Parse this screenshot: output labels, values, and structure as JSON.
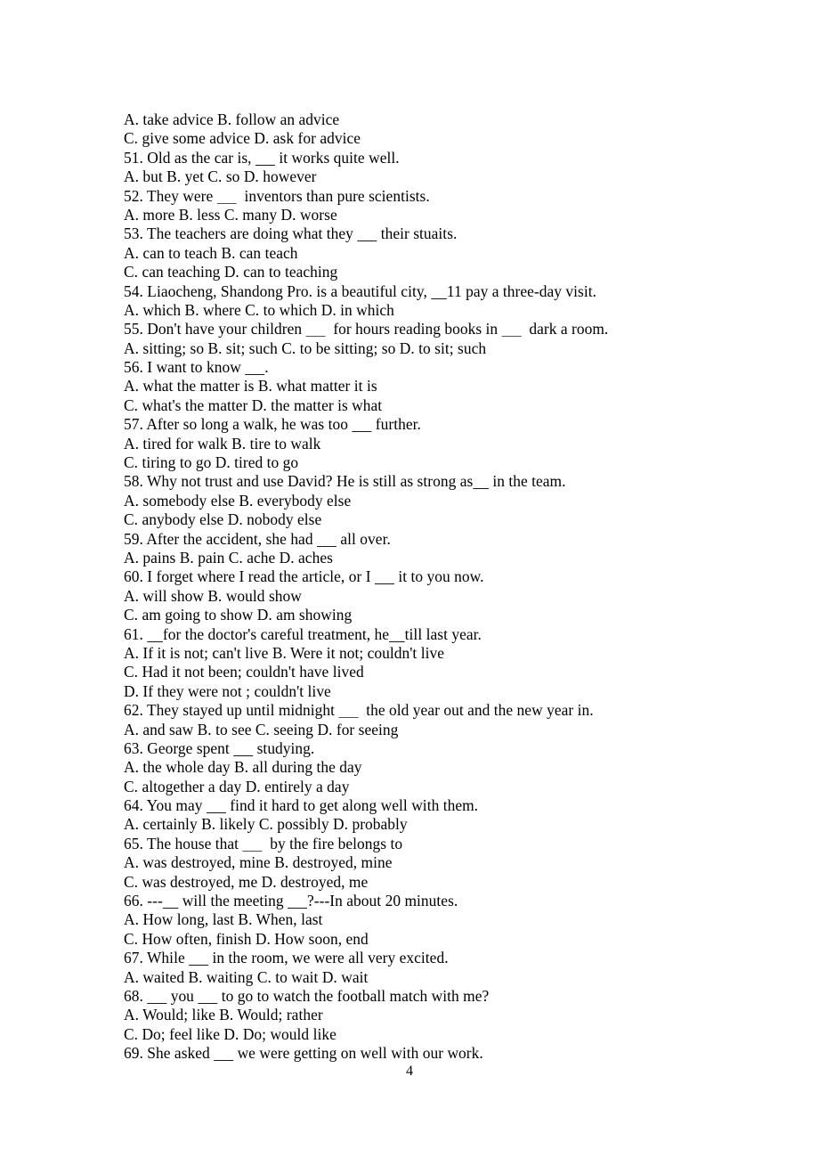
{
  "document": {
    "page_number": "4",
    "lines": [
      {
        "id": "line-opt-50-ab",
        "segments": [
          {
            "t": "A. take advice B. follow an advice"
          }
        ]
      },
      {
        "id": "line-opt-50-cd",
        "segments": [
          {
            "t": "C. give some advice D. ask for advice"
          }
        ]
      },
      {
        "id": "line-q51",
        "segments": [
          {
            "t": "51. Old as the car is, "
          },
          {
            "blank": "_____"
          },
          {
            "t": " it works quite well."
          }
        ]
      },
      {
        "id": "line-opt-51-ab",
        "segments": [
          {
            "t": "A. but B. yet C. so D. however"
          }
        ]
      },
      {
        "id": "line-q52",
        "segments": [
          {
            "t": "52. They were "
          },
          {
            "blank": "_____",
            "faint": true
          },
          {
            "t": "  inventors than pure scientists."
          }
        ]
      },
      {
        "id": "line-opt-52",
        "segments": [
          {
            "t": "A. more B. less C. many D. worse"
          }
        ]
      },
      {
        "id": "line-q53",
        "segments": [
          {
            "t": "53. The teachers are doing what they "
          },
          {
            "blank": "_____"
          },
          {
            "t": " their stuaits."
          }
        ]
      },
      {
        "id": "line-opt-53-ab",
        "segments": [
          {
            "t": "A. can to teach B. can teach"
          }
        ]
      },
      {
        "id": "line-opt-53-cd",
        "segments": [
          {
            "t": "C. can teaching D. can to teaching"
          }
        ]
      },
      {
        "id": "line-q54",
        "segments": [
          {
            "t": "54. Liaocheng, Shandong Pro. is a beautiful city, "
          },
          {
            "blank": "____"
          },
          {
            "t": "11 pay a three-day visit."
          }
        ]
      },
      {
        "id": "line-opt-54",
        "segments": [
          {
            "t": "A. which B. where C. to which D. in which"
          }
        ]
      },
      {
        "id": "line-q55",
        "segments": [
          {
            "t": "55. Don't have your children "
          },
          {
            "blank": "_____",
            "faint": true
          },
          {
            "t": "  for hours reading books in "
          },
          {
            "blank": "_____",
            "faint": true
          },
          {
            "t": "  dark a room."
          }
        ]
      },
      {
        "id": "line-opt-55",
        "segments": [
          {
            "t": "A. sitting; so B. sit; such C. to be sitting; so D. to sit; such"
          }
        ]
      },
      {
        "id": "line-q56",
        "segments": [
          {
            "t": "56. I want to know "
          },
          {
            "blank": "_____"
          },
          {
            "t": "."
          }
        ]
      },
      {
        "id": "line-opt-56-ab",
        "segments": [
          {
            "t": "A. what the matter is B. what matter it is"
          }
        ]
      },
      {
        "id": "line-opt-56-cd",
        "segments": [
          {
            "t": "C. what's the matter D. the matter is what"
          }
        ]
      },
      {
        "id": "line-q57",
        "segments": [
          {
            "t": "57. After so long a walk, he was too "
          },
          {
            "blank": "_____"
          },
          {
            "t": " further."
          }
        ]
      },
      {
        "id": "line-opt-57-ab",
        "segments": [
          {
            "t": "A. tired for walk B. tire to walk"
          }
        ]
      },
      {
        "id": "line-opt-57-cd",
        "segments": [
          {
            "t": "C. tiring to go D. tired to go"
          }
        ]
      },
      {
        "id": "line-q58",
        "segments": [
          {
            "t": "58. Why not trust and use David? He is still as strong as"
          },
          {
            "blank": "____"
          },
          {
            "t": " in the team."
          }
        ]
      },
      {
        "id": "line-opt-58-ab",
        "segments": [
          {
            "t": "A. somebody else B. everybody else"
          }
        ]
      },
      {
        "id": "line-opt-58-cd",
        "segments": [
          {
            "t": "C. anybody else D. nobody else"
          }
        ]
      },
      {
        "id": "line-q59",
        "segments": [
          {
            "t": "59. After the accident, she had "
          },
          {
            "blank": "_____"
          },
          {
            "t": " all over."
          }
        ]
      },
      {
        "id": "line-opt-59",
        "segments": [
          {
            "t": "A. pains B. pain C. ache D. aches"
          }
        ]
      },
      {
        "id": "line-q60",
        "segments": [
          {
            "t": "60. I forget where I read the article, or I "
          },
          {
            "blank": "_____"
          },
          {
            "t": " it to you now."
          }
        ]
      },
      {
        "id": "line-opt-60-ab",
        "segments": [
          {
            "t": "A. will show B. would show"
          }
        ]
      },
      {
        "id": "line-opt-60-cd",
        "segments": [
          {
            "t": "C. am going to show D. am showing"
          }
        ]
      },
      {
        "id": "line-q61",
        "segments": [
          {
            "t": "61. "
          },
          {
            "blank": "____"
          },
          {
            "t": "for the doctor's careful treatment, he"
          },
          {
            "blank": "____"
          },
          {
            "t": "till last year."
          }
        ]
      },
      {
        "id": "line-opt-61-ab",
        "segments": [
          {
            "t": "A. If it is not; can't live B. Were it not; couldn't live"
          }
        ]
      },
      {
        "id": "line-opt-61-c",
        "segments": [
          {
            "t": "C. Had it not been; couldn't have lived"
          }
        ]
      },
      {
        "id": "line-opt-61-d",
        "segments": [
          {
            "t": "D. If they were not ; couldn't live"
          }
        ]
      },
      {
        "id": "line-q62",
        "segments": [
          {
            "t": "62. They stayed up until midnight "
          },
          {
            "blank": "_____",
            "faint": true
          },
          {
            "t": "  the old year out and the new year in."
          }
        ]
      },
      {
        "id": "line-opt-62",
        "segments": [
          {
            "t": "A. and saw B. to see C. seeing D. for seeing"
          }
        ]
      },
      {
        "id": "line-q63",
        "segments": [
          {
            "t": "63. George spent "
          },
          {
            "blank": "_____"
          },
          {
            "t": " studying."
          }
        ]
      },
      {
        "id": "line-opt-63-ab",
        "segments": [
          {
            "t": "A. the whole day B. all during the day"
          }
        ]
      },
      {
        "id": "line-opt-63-cd",
        "segments": [
          {
            "t": "C. altogether a day D. entirely a day"
          }
        ]
      },
      {
        "id": "line-q64",
        "segments": [
          {
            "t": "64. You may "
          },
          {
            "blank": "_____"
          },
          {
            "t": " find it hard to get along well with them."
          }
        ]
      },
      {
        "id": "line-opt-64",
        "segments": [
          {
            "t": "A. certainly B. likely C. possibly D. probably"
          }
        ]
      },
      {
        "id": "line-q65",
        "segments": [
          {
            "t": "65. The house that "
          },
          {
            "blank": "_____",
            "faint": true
          },
          {
            "t": "  by the fire belongs to"
          }
        ]
      },
      {
        "id": "line-opt-65-ab",
        "segments": [
          {
            "t": "A. was destroyed, mine B. destroyed, mine"
          }
        ]
      },
      {
        "id": "line-opt-65-cd",
        "segments": [
          {
            "t": "C. was destroyed, me D. destroyed, me"
          }
        ]
      },
      {
        "id": "line-q66",
        "segments": [
          {
            "t": "66. ---"
          },
          {
            "blank": "____"
          },
          {
            "t": " will the meeting "
          },
          {
            "blank": "_____"
          },
          {
            "t": "?---In about 20 minutes."
          }
        ]
      },
      {
        "id": "line-opt-66-ab",
        "segments": [
          {
            "t": "A. How long, last B. When, last"
          }
        ]
      },
      {
        "id": "line-opt-66-cd",
        "segments": [
          {
            "t": "C. How often, finish D. How soon, end"
          }
        ]
      },
      {
        "id": "line-q67",
        "segments": [
          {
            "t": "67. While "
          },
          {
            "blank": "_____"
          },
          {
            "t": " in the room, we were all very excited."
          }
        ]
      },
      {
        "id": "line-opt-67",
        "segments": [
          {
            "t": "A. waited B. waiting C. to wait D. wait"
          }
        ]
      },
      {
        "id": "line-q68",
        "segments": [
          {
            "t": "68. "
          },
          {
            "blank": "_____"
          },
          {
            "t": " you "
          },
          {
            "blank": "_____"
          },
          {
            "t": " to go to watch the football match with me?"
          }
        ]
      },
      {
        "id": "line-opt-68-ab",
        "segments": [
          {
            "t": "A. Would; like B. Would; rather"
          }
        ]
      },
      {
        "id": "line-opt-68-cd",
        "segments": [
          {
            "t": "C. Do; feel like D. Do; would like"
          }
        ]
      },
      {
        "id": "line-q69",
        "segments": [
          {
            "t": "69. She asked "
          },
          {
            "blank": "_____"
          },
          {
            "t": " we were getting on well with our work."
          }
        ]
      }
    ]
  }
}
